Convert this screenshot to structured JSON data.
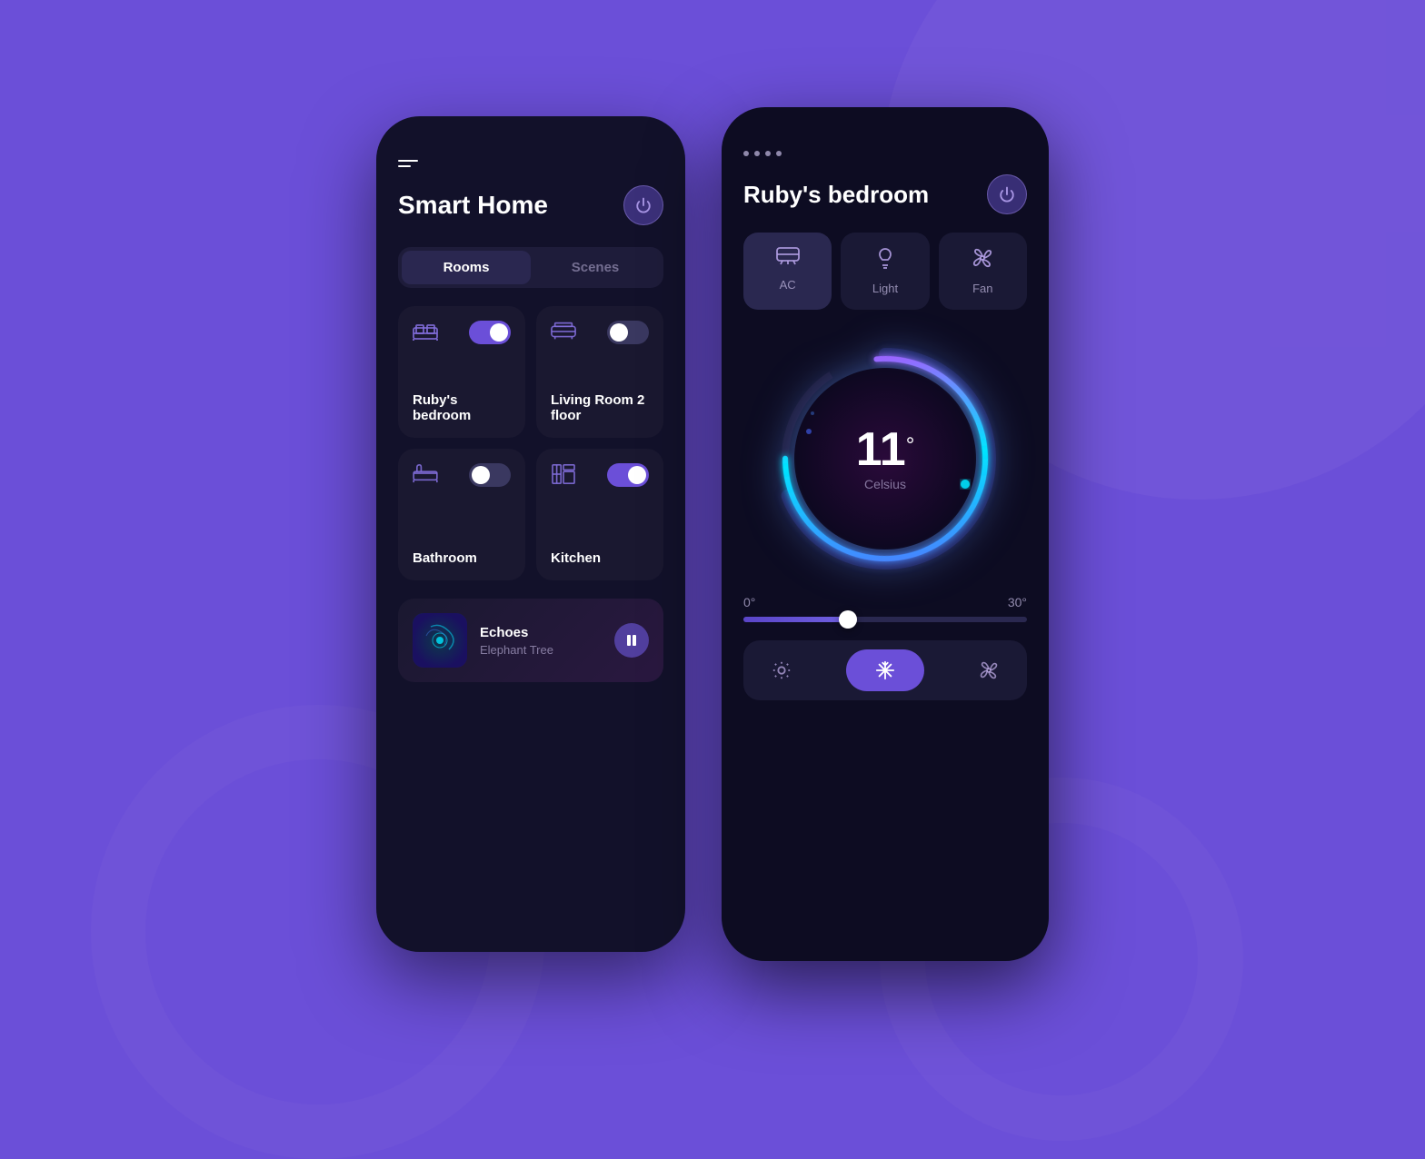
{
  "background": {
    "color": "#6B4FD8"
  },
  "phone1": {
    "title": "Smart Home",
    "tabs": [
      {
        "label": "Rooms",
        "active": true
      },
      {
        "label": "Scenes",
        "active": false
      }
    ],
    "rooms": [
      {
        "name": "Ruby's bedroom",
        "icon": "🛏",
        "toggle": "on"
      },
      {
        "name": "Living Room 2 floor",
        "icon": "🛋",
        "toggle": "off"
      },
      {
        "name": "Bathroom",
        "icon": "🛁",
        "toggle": "off"
      },
      {
        "name": "Kitchen",
        "icon": "🏠",
        "toggle": "on"
      }
    ],
    "music": {
      "title": "Echoes",
      "artist": "Elephant Tree",
      "playing": true
    }
  },
  "phone2": {
    "title": "Ruby's bedroom",
    "devices": [
      {
        "label": "AC",
        "icon": "ac",
        "active": true
      },
      {
        "label": "Light",
        "icon": "light",
        "active": false
      },
      {
        "label": "Fan",
        "icon": "fan",
        "active": false
      }
    ],
    "temperature": {
      "value": "11",
      "unit": "°",
      "scale": "Celsius"
    },
    "slider": {
      "min": "0°",
      "max": "30°",
      "value": 37
    },
    "modes": [
      {
        "label": "sun",
        "active": false
      },
      {
        "label": "snow",
        "active": true
      },
      {
        "label": "fan",
        "active": false
      }
    ]
  }
}
